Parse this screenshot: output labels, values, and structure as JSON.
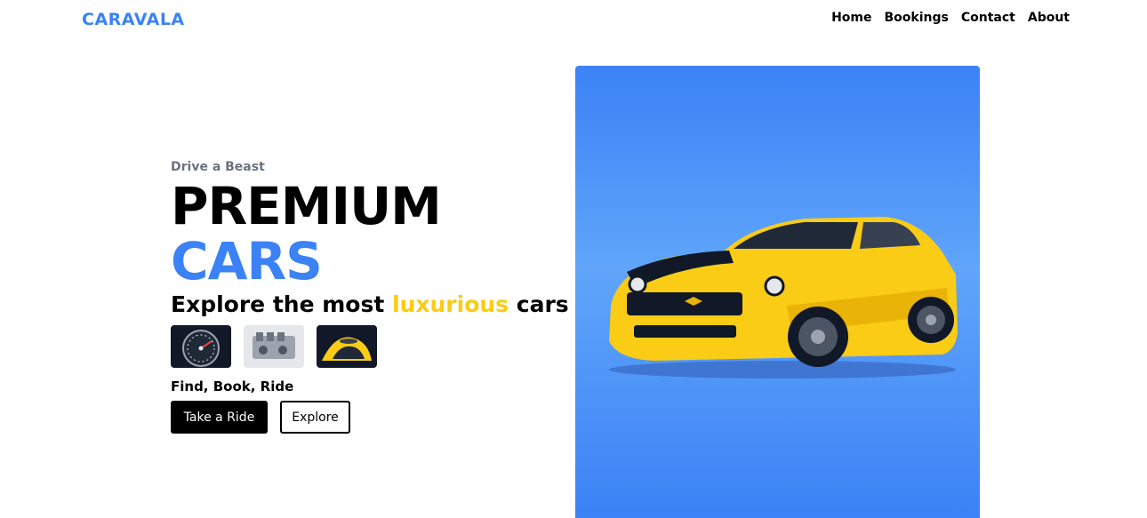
{
  "brand": {
    "name": "CARAVALA",
    "color": "#3b82f6"
  },
  "nav": {
    "items": [
      "Home",
      "Bookings",
      "Contact",
      "About"
    ]
  },
  "hero": {
    "eyebrow": "Drive a Beast",
    "headline_line1": "PREMIUM",
    "headline_line2": "CARS",
    "tagline_prefix": "Explore the most ",
    "tagline_highlight": "luxurious",
    "tagline_suffix": " cars !",
    "highlight_color": "#facc15",
    "thumbnails": [
      "speedometer-image",
      "engine-image",
      "car-interior-image"
    ],
    "slogan": "Find, Book, Ride",
    "primary_button": "Take a Ride",
    "secondary_button": "Explore",
    "panel_color": "#3b82f6",
    "car_image": "yellow-sports-car-image"
  }
}
